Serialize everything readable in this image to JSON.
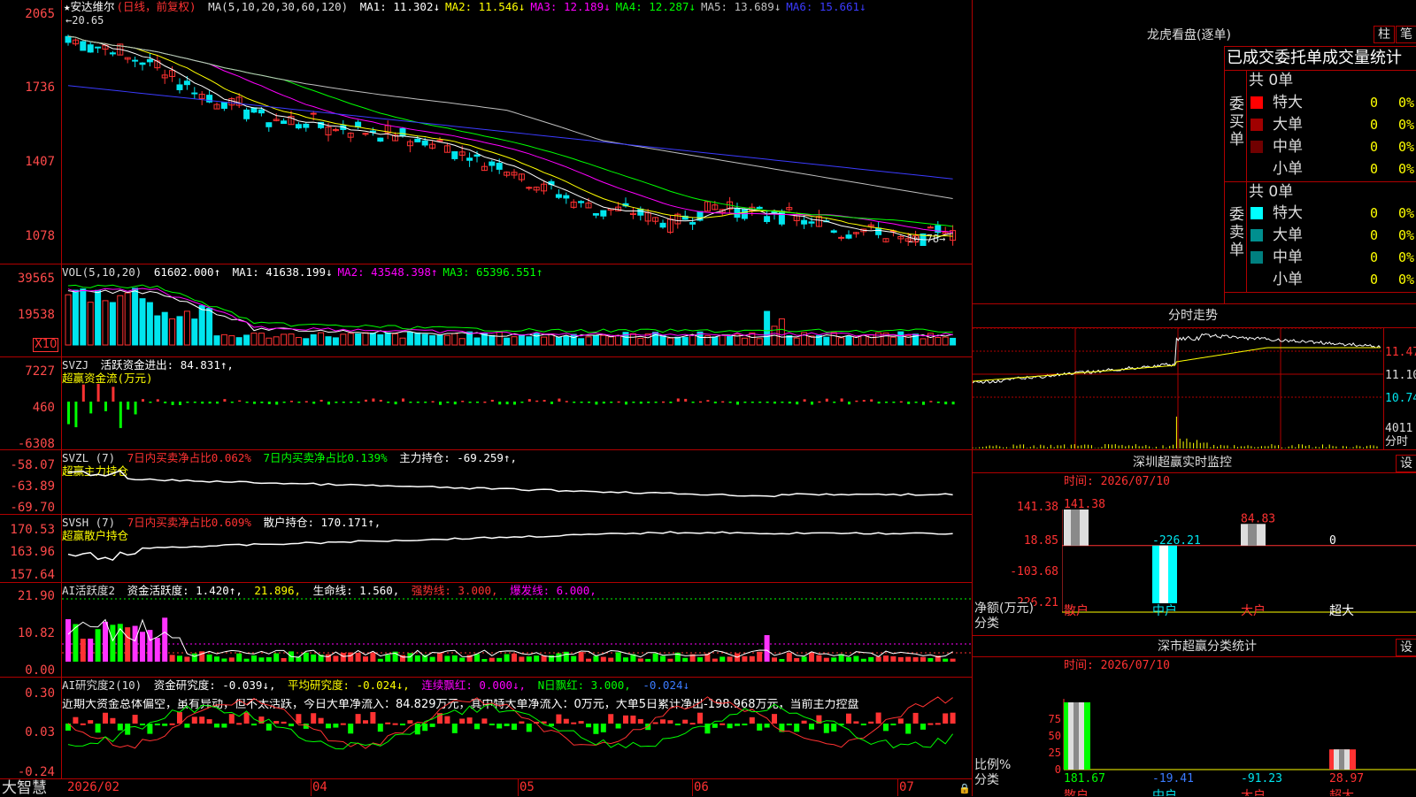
{
  "app": {
    "brand": "大智慧"
  },
  "colors": {
    "up": "#ff3232",
    "down": "#00e5ee",
    "grid": "#b00000",
    "bg": "#000000"
  },
  "kline": {
    "stock_name": "★安达维尔",
    "period": "(日线，前复权)",
    "ma_title": "MA(5,10,20,30,60,120)",
    "ma": [
      {
        "label": "MA1: 11.302↓",
        "color": "#ffffff"
      },
      {
        "label": "MA2: 11.546↓",
        "color": "#ffff00"
      },
      {
        "label": "MA3: 12.189↓",
        "color": "#ff00ff"
      },
      {
        "label": "MA4: 12.287↓",
        "color": "#00ff00"
      },
      {
        "label": "MA5: 13.689↓",
        "color": "#c0c0c0"
      },
      {
        "label": "MA6: 15.661↓",
        "color": "#3b3bff"
      }
    ],
    "yaxis": [
      "2065",
      "1736",
      "1407",
      "1078"
    ],
    "high_label": "←20.65",
    "low_label": "10.78→"
  },
  "vol": {
    "title": "VOL(5,10,20)",
    "value": "61602.000↑",
    "ma": [
      {
        "label": "MA1: 41638.199↓",
        "color": "#ffffff"
      },
      {
        "label": "MA2: 43548.398↑",
        "color": "#ff00ff"
      },
      {
        "label": "MA3: 65396.551↑",
        "color": "#00ff00"
      }
    ],
    "yaxis": [
      "39565",
      "19538"
    ],
    "unit": "X10"
  },
  "svzj": {
    "title": "SVZJ",
    "text": "活跃资金进出: 84.831↑,",
    "subtitle": "超赢资金流(万元)",
    "yaxis": [
      "7227",
      "460",
      "-6308"
    ]
  },
  "svzl": {
    "title": "SVZL (7)",
    "t1": "7日内买卖净占比0.062%",
    "t2": "7日内买卖净占比0.139%",
    "t3": "主力持仓: -69.259↑,",
    "subtitle": "超赢主力持仓",
    "yaxis": [
      "-58.07",
      "-63.89",
      "-69.70"
    ]
  },
  "svsh": {
    "title": "SVSH (7)",
    "t1": "7日内买卖净占比0.609%",
    "t2": "散户持仓: 170.171↑,",
    "subtitle": "超赢散户持仓",
    "yaxis": [
      "170.53",
      "163.96",
      "157.64"
    ]
  },
  "ai1": {
    "title": "AI活跃度2",
    "t1": "资金活跃度: 1.420↑,",
    "t2": "21.896,",
    "t3": "生命线: 1.560,",
    "t4": "强势线: 3.000,",
    "t5": "爆发线: 6.000,",
    "yaxis": [
      "21.90",
      "10.82",
      "0.00"
    ]
  },
  "ai2": {
    "title": "AI研究度2(10)",
    "t1": "资金研究度: -0.039↓,",
    "t2": "平均研究度: -0.024↓,",
    "t3": "连续飘红: 0.000↓,",
    "t4": "N日飘红: 3.000,",
    "t5": "-0.024↓",
    "comment": "近期大资金总体偏空，虽有异动，但不太活跃，今日大单净流入：84.829万元，其中特大单净流入：0万元，大单5日累计净出-198.968万元，当前主力控盘",
    "yaxis": [
      "0.30",
      "0.03",
      "-0.24"
    ]
  },
  "xaxis": [
    "2026/02",
    "04",
    "05",
    "06",
    "07"
  ],
  "lhb": {
    "title": "龙虎看盘(逐单)",
    "btn1": "柱",
    "btn2": "笔",
    "tabs": "已成交委托单成交量统计",
    "buy": {
      "side": "委买单",
      "total": "共 0单",
      "rows": [
        {
          "name": "特大",
          "v": "0",
          "p": "0%",
          "color": "#ff0000"
        },
        {
          "name": "大单",
          "v": "0",
          "p": "0%",
          "color": "#a00000"
        },
        {
          "name": "中单",
          "v": "0",
          "p": "0%",
          "color": "#700000"
        },
        {
          "name": "小单",
          "v": "0",
          "p": "0%",
          "color": "#000000"
        }
      ]
    },
    "sell": {
      "side": "委卖单",
      "total": "共 0单",
      "rows": [
        {
          "name": "特大",
          "v": "0",
          "p": "0%",
          "color": "#00ffff"
        },
        {
          "name": "大单",
          "v": "0",
          "p": "0%",
          "color": "#008f8f"
        },
        {
          "name": "中单",
          "v": "0",
          "p": "0%",
          "color": "#008080"
        },
        {
          "name": "小单",
          "v": "0",
          "p": "0%",
          "color": "#000000"
        }
      ]
    }
  },
  "intraday": {
    "title": "分时走势",
    "prices": [
      "11.47",
      "11.10",
      "10.74"
    ],
    "vol": "4011",
    "vol_unit": "分时"
  },
  "monitor": {
    "title": "深圳超赢实时监控",
    "btn": "设",
    "time": "时间: 2026/07/10",
    "yaxis": [
      "141.38",
      "18.85",
      "-103.68",
      "-226.21"
    ],
    "ylabel": "净额(万元)",
    "xlabel": "分类",
    "cats": [
      "散户",
      "中户",
      "大户",
      "超大"
    ],
    "values": [
      141.38,
      -226.21,
      84.83,
      0
    ],
    "labels": [
      "141.38",
      "-226.21",
      "84.83",
      "0"
    ]
  },
  "classify": {
    "title": "深市超赢分类统计",
    "btn": "设",
    "time": "时间: 2026/07/10",
    "yaxis": [
      "75",
      "50",
      "25",
      "0"
    ],
    "ylabel": "比例%",
    "xlabel": "分类",
    "cats": [
      "散户",
      "中户",
      "大户",
      "超大"
    ],
    "percent": [
      100,
      0,
      0,
      30
    ],
    "labels": [
      "181.67",
      "-19.41",
      "-91.23",
      "28.97"
    ]
  },
  "chart_data": [
    {
      "type": "bar",
      "title": "深圳超赢实时监控",
      "categories": [
        "散户",
        "中户",
        "大户",
        "超大"
      ],
      "values": [
        141.38,
        -226.21,
        84.83,
        0
      ],
      "ylabel": "净额(万元)",
      "ylim": [
        -226.21,
        141.38
      ]
    },
    {
      "type": "bar",
      "title": "深市超赢分类统计",
      "categories": [
        "散户",
        "中户",
        "大户",
        "超大"
      ],
      "values": [
        181.67,
        -19.41,
        -91.23,
        28.97
      ],
      "ylabel": "比例%",
      "ylim": [
        0,
        100
      ]
    }
  ]
}
